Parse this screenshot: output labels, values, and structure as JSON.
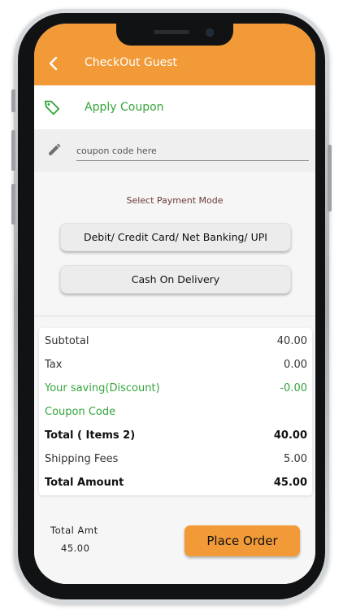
{
  "header": {
    "title": "CheckOut Guest",
    "back_icon": "chevron-left-icon",
    "background_color": "#f29a38"
  },
  "coupon": {
    "apply_label": "Apply Coupon",
    "tag_icon": "tag-icon",
    "input_placeholder": "coupon code here",
    "input_value": "",
    "pencil_icon": "pencil-icon",
    "accent_color": "#35a63c"
  },
  "payment": {
    "mode_label": "Select Payment Mode",
    "options": [
      "Debit/ Credit Card/ Net Banking/ UPI",
      "Cash On Delivery"
    ]
  },
  "summary": {
    "rows": [
      {
        "label": "Subtotal",
        "value": "40.00"
      },
      {
        "label": "Tax",
        "value": "0.00"
      },
      {
        "label": "Your saving(Discount)",
        "value": "-0.00"
      },
      {
        "label": "Coupon Code",
        "value": ""
      },
      {
        "label": "Total ( Items 2)",
        "value": "40.00"
      },
      {
        "label": "Shipping Fees",
        "value": "5.00"
      },
      {
        "label": "Total Amount",
        "value": "45.00"
      }
    ]
  },
  "footer": {
    "total_amt_label": "Total Amt",
    "total_amt_value": "45.00",
    "place_order_label": "Place Order"
  }
}
